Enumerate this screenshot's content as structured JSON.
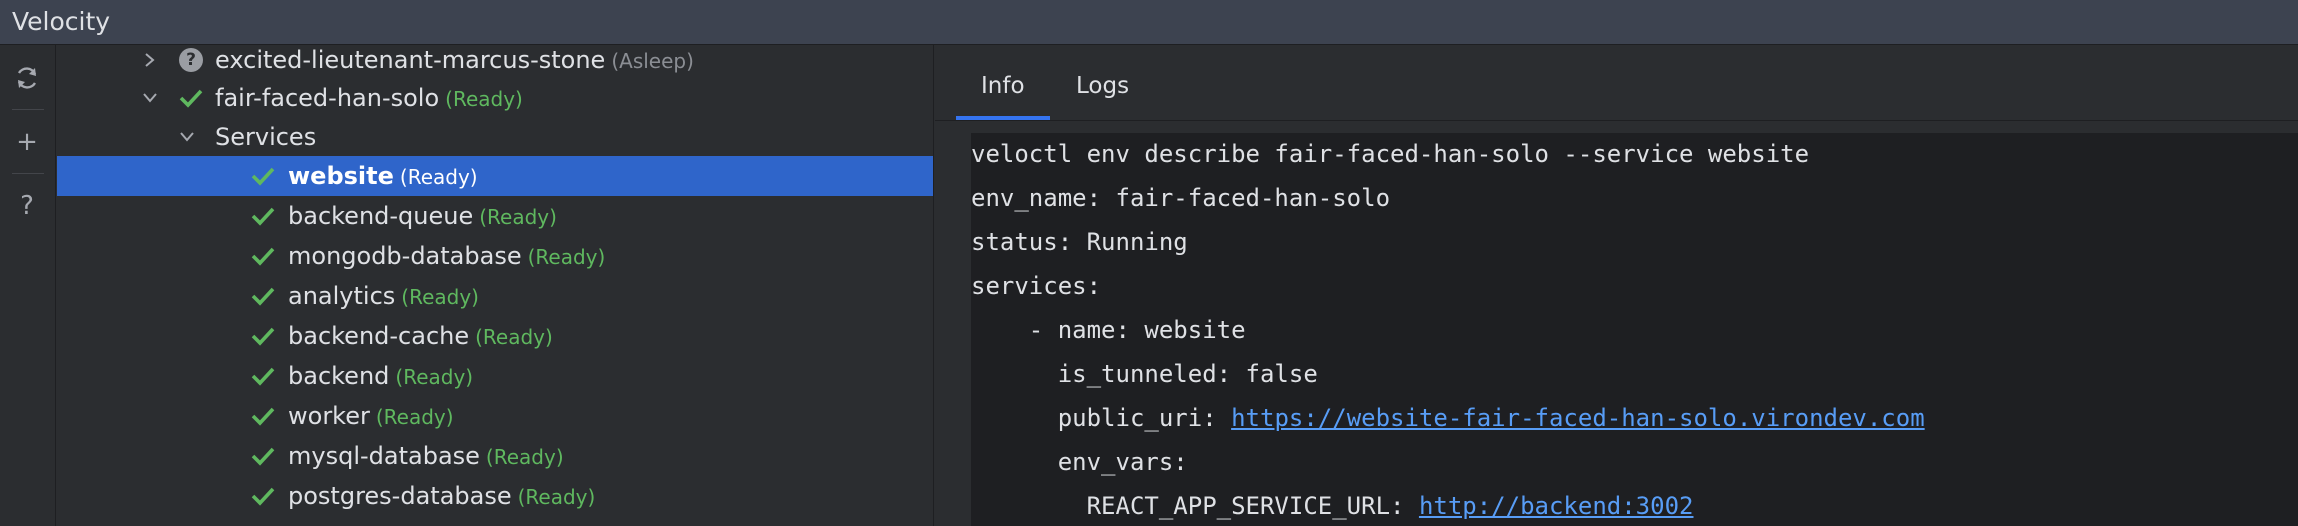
{
  "window": {
    "title": "Velocity"
  },
  "toolbar": {
    "refresh_icon": "refresh-icon",
    "add_icon": "plus-icon",
    "help_icon": "question-icon",
    "add_label": "+",
    "help_label": "?"
  },
  "tree": {
    "env1": {
      "name": "excited-lieutenant-marcus-stone",
      "status": "(Asleep)"
    },
    "env2": {
      "name": "fair-faced-han-solo",
      "status": "(Ready)"
    },
    "services_group": {
      "label": "Services"
    },
    "services": [
      {
        "name": "website",
        "status": "(Ready)"
      },
      {
        "name": "backend-queue",
        "status": "(Ready)"
      },
      {
        "name": "mongodb-database",
        "status": "(Ready)"
      },
      {
        "name": "analytics",
        "status": "(Ready)"
      },
      {
        "name": "backend-cache",
        "status": "(Ready)"
      },
      {
        "name": "backend",
        "status": "(Ready)"
      },
      {
        "name": "worker",
        "status": "(Ready)"
      },
      {
        "name": "mysql-database",
        "status": "(Ready)"
      },
      {
        "name": "postgres-database",
        "status": "(Ready)"
      }
    ]
  },
  "tabs": [
    {
      "label": "Info",
      "active": true
    },
    {
      "label": "Logs",
      "active": false
    }
  ],
  "console": {
    "line1": "veloctl env describe fair-faced-han-solo --service website",
    "line2": "env_name: fair-faced-han-solo",
    "line3": "status: Running",
    "line4": "services:",
    "line5": "    - name: website",
    "line6": "      is_tunneled: false",
    "line7_key": "      public_uri: ",
    "line7_link": "https://website-fair-faced-han-solo.virondev.com",
    "line8": "      env_vars:",
    "line9_key": "        REACT_APP_SERVICE_URL: ",
    "line9_link": "http://backend:3002"
  },
  "colors": {
    "selection": "#2f65ca",
    "ready": "#5fb85f",
    "link": "#589df6",
    "tab_accent": "#3574f0"
  }
}
